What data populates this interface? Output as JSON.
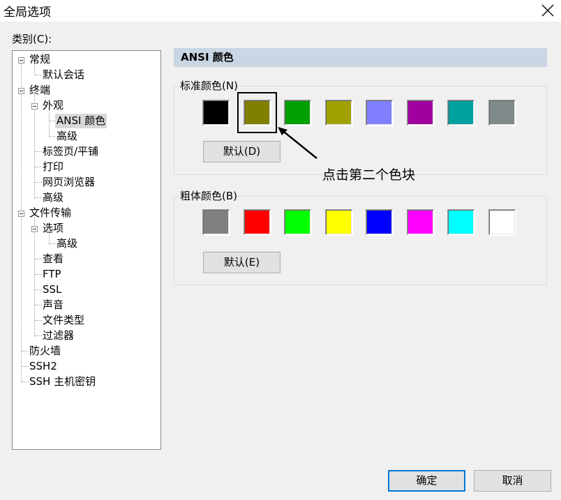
{
  "window": {
    "title": "全局选项"
  },
  "category_label": "类别(C):",
  "tree": {
    "items": [
      {
        "label": "常规"
      },
      {
        "label": "默认会话"
      },
      {
        "label": "终端"
      },
      {
        "label": "外观"
      },
      {
        "label": "ANSI 颜色",
        "selected": true
      },
      {
        "label": "高级"
      },
      {
        "label": "标签页/平铺"
      },
      {
        "label": "打印"
      },
      {
        "label": "网页浏览器"
      },
      {
        "label": "高级"
      },
      {
        "label": "文件传输"
      },
      {
        "label": "选项"
      },
      {
        "label": "高级"
      },
      {
        "label": "查看"
      },
      {
        "label": "FTP"
      },
      {
        "label": "SSL"
      },
      {
        "label": "声音"
      },
      {
        "label": "文件类型"
      },
      {
        "label": "过滤器"
      },
      {
        "label": "防火墙"
      },
      {
        "label": "SSH2"
      },
      {
        "label": "SSH 主机密钥"
      }
    ]
  },
  "panel": {
    "header": "ANSI 颜色",
    "standard": {
      "title": "标准颜色(N)",
      "colors": [
        "#000000",
        "#808000",
        "#00a000",
        "#a0a000",
        "#8080ff",
        "#a000a0",
        "#00a0a0",
        "#808a8a"
      ],
      "default_button": "默认(D)"
    },
    "bold": {
      "title": "粗体颜色(B)",
      "colors": [
        "#808080",
        "#ff0000",
        "#00ff00",
        "#ffff00",
        "#0000ff",
        "#ff00ff",
        "#00ffff",
        "#ffffff"
      ],
      "default_button": "默认(E)"
    }
  },
  "annotation": {
    "text": "点击第二个色块"
  },
  "buttons": {
    "ok": "确定",
    "cancel": "取消"
  }
}
